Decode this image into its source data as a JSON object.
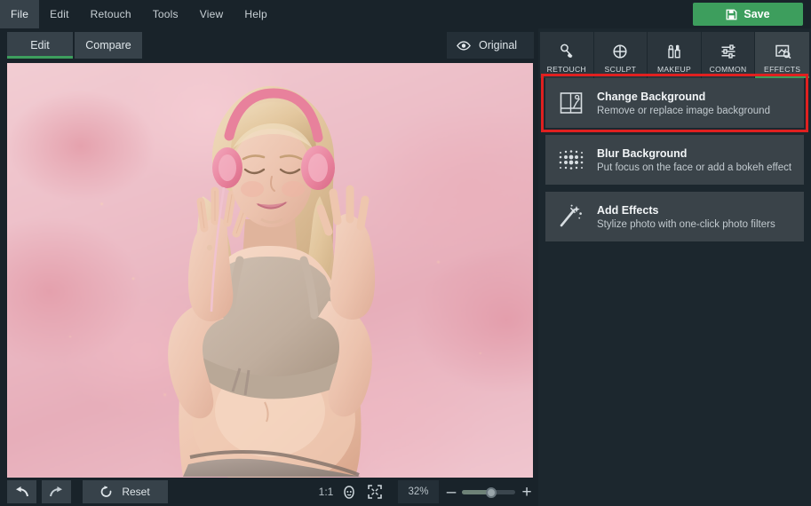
{
  "app": {
    "accent_green": "#3d9e5d",
    "highlight_red": "#e02020",
    "panel_bg": "#1c272e",
    "chrome_bg": "#19232a"
  },
  "menubar": {
    "items": [
      {
        "label": "File",
        "active": true
      },
      {
        "label": "Edit",
        "active": false
      },
      {
        "label": "Retouch",
        "active": false
      },
      {
        "label": "Tools",
        "active": false
      },
      {
        "label": "View",
        "active": false
      },
      {
        "label": "Help",
        "active": false
      }
    ],
    "save": {
      "label": "Save",
      "icon": "save-floppy-icon"
    }
  },
  "view_tabs": {
    "edit": {
      "label": "Edit",
      "active": true
    },
    "compare": {
      "label": "Compare",
      "active": false
    },
    "original": {
      "label": "Original",
      "icon": "eye-icon"
    }
  },
  "canvas": {
    "description": "Portrait photo of a smiling blonde woman wearing pink headphones against a blurred pink floral background"
  },
  "bottombar": {
    "undo": {
      "label": "",
      "icon": "undo-arrow-icon"
    },
    "redo": {
      "label": "",
      "icon": "redo-arrow-icon"
    },
    "reset": {
      "label": "Reset",
      "icon": "reset-circular-arrow-icon"
    },
    "one_to_one": "1:1",
    "face_zoom_icon": "face-zoom-icon",
    "fit_screen_icon": "fit-to-screen-icon",
    "zoom_value": "32%",
    "zoom_minus": "–",
    "zoom_plus": "+",
    "slider_percent": 55
  },
  "right_panel": {
    "category_tabs": [
      {
        "label": "RETOUCH",
        "icon": "retouch-brush-icon",
        "active": false
      },
      {
        "label": "SCULPT",
        "icon": "sculpt-target-icon",
        "active": false
      },
      {
        "label": "MAKEUP",
        "icon": "makeup-lipstick-icon",
        "active": false
      },
      {
        "label": "COMMON",
        "icon": "common-sliders-icon",
        "active": false
      },
      {
        "label": "EFFECTS",
        "icon": "effects-frame-icon",
        "active": true
      }
    ],
    "options": [
      {
        "title": "Change Background",
        "subtitle": "Remove or replace image background",
        "icon": "change-background-icon",
        "highlighted": true
      },
      {
        "title": "Blur Background",
        "subtitle": "Put focus on the face or add a bokeh effect",
        "icon": "blur-background-dots-icon",
        "highlighted": false
      },
      {
        "title": "Add Effects",
        "subtitle": "Stylize photo with one-click photo filters",
        "icon": "magic-wand-icon",
        "highlighted": false
      }
    ]
  }
}
